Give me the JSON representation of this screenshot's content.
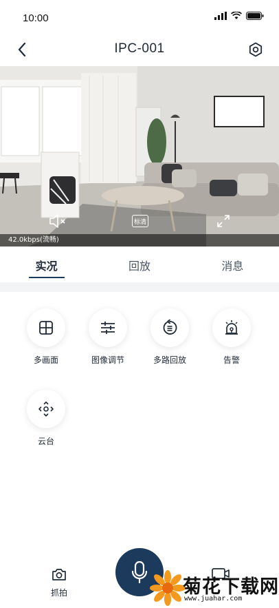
{
  "status_bar": {
    "time": "10:00"
  },
  "nav": {
    "title": "IPC-001"
  },
  "video": {
    "bitrate": "42.0kbps(流畅)",
    "quality_label": "标清"
  },
  "tabs": [
    {
      "label": "实况",
      "active": true
    },
    {
      "label": "回放",
      "active": false
    },
    {
      "label": "消息",
      "active": false
    }
  ],
  "functions": [
    {
      "label": "多画面",
      "icon": "grid-icon"
    },
    {
      "label": "图像调节",
      "icon": "sliders-icon"
    },
    {
      "label": "多路回放",
      "icon": "replay-icon"
    },
    {
      "label": "告警",
      "icon": "alarm-icon"
    },
    {
      "label": "云台",
      "icon": "ptz-icon"
    }
  ],
  "bottom": {
    "snapshot_label": "抓拍"
  },
  "watermark": {
    "title": "菊花下载网",
    "url": "www.juahar.com"
  },
  "colors": {
    "accent": "#1c3a5c",
    "divider": "#f3f4f6"
  }
}
